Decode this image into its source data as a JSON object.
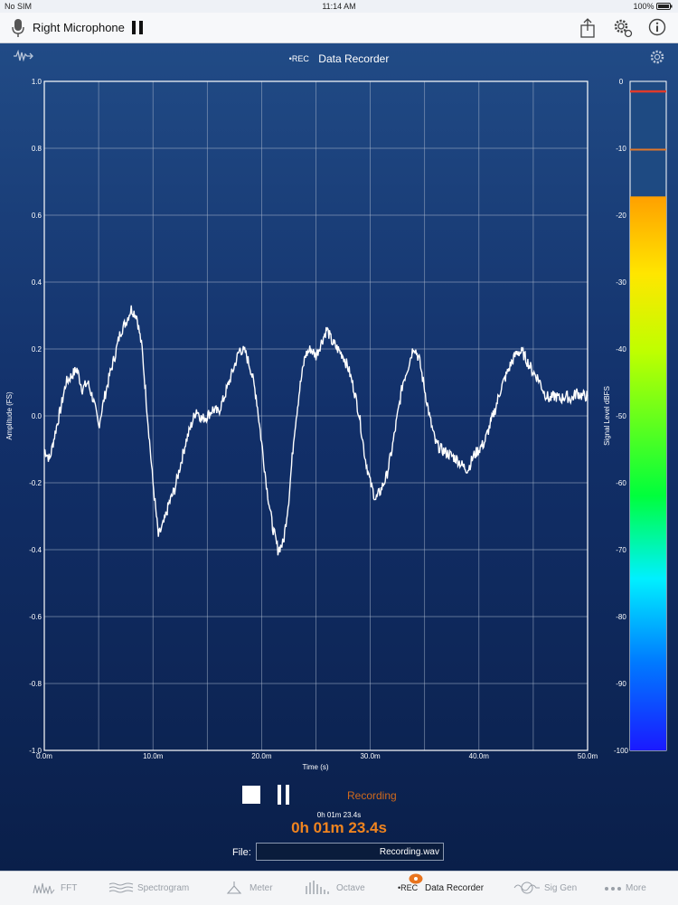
{
  "status_bar": {
    "carrier": "No SIM",
    "time": "11:14 AM",
    "battery": "100%"
  },
  "toolbar": {
    "input_source": "Right Microphone",
    "icons": [
      "microphone-icon",
      "pause-icon",
      "share-icon",
      "settings-icon",
      "info-icon"
    ]
  },
  "header": {
    "rec_tag": "•REC",
    "title": "Data Recorder"
  },
  "colors": {
    "trace": "#ffffff",
    "grid": "#aab7cc",
    "accent": "#f0841f",
    "background": "#0b2450"
  },
  "chart_data": [
    {
      "type": "line",
      "xlabel": "Time (s)",
      "ylabel": "Amplitude (FS)",
      "xlim": [
        0,
        50
      ],
      "ylim": [
        -1,
        1
      ],
      "grid": true,
      "x_ticks": [
        "0.0m",
        "10.0m",
        "20.0m",
        "30.0m",
        "40.0m",
        "50.0m"
      ],
      "y_ticks": [
        "1.0",
        "0.8",
        "0.6",
        "0.4",
        "0.2",
        "0.0",
        "-0.2",
        "-0.4",
        "-0.6",
        "-0.8",
        "-1.0"
      ],
      "series": [
        {
          "x": [
            0,
            0.5,
            1.0,
            1.5,
            2.0,
            2.5,
            3.0,
            3.5,
            4.0,
            4.5,
            5.0,
            5.5,
            6.0,
            6.5,
            7.0,
            7.5,
            8.0,
            8.5,
            9.0,
            9.5,
            10.0,
            10.5,
            11.0,
            11.5,
            12.0,
            12.5,
            13.0,
            13.5,
            14.0,
            14.5,
            15.0,
            15.5,
            16.0,
            16.5,
            17.0,
            17.5,
            18.0,
            18.5,
            19.0,
            19.5,
            20.0,
            20.5,
            21.0,
            21.5,
            22.0,
            22.5,
            23.0,
            23.5,
            24.0,
            24.5,
            25.0,
            25.5,
            26.0,
            26.5,
            27.0,
            27.5,
            28.0,
            28.5,
            29.0,
            29.5,
            30.0,
            30.5,
            31.0,
            31.5,
            32.0,
            32.5,
            33.0,
            33.5,
            34.0,
            34.5,
            35.0,
            35.5,
            36.0,
            36.5,
            37.0,
            37.5,
            38.0,
            38.5,
            39.0,
            39.5,
            40.0,
            40.5,
            41.0,
            41.5,
            42.0,
            42.5,
            43.0,
            43.5,
            44.0,
            44.5,
            45.0,
            45.5,
            46.0,
            46.5,
            47.0,
            47.5,
            48.0,
            48.5,
            49.0,
            49.5,
            50.0
          ],
          "y": [
            -0.1,
            -0.13,
            -0.05,
            0.02,
            0.1,
            0.12,
            0.14,
            0.08,
            0.1,
            0.05,
            -0.03,
            0.05,
            0.12,
            0.18,
            0.25,
            0.28,
            0.32,
            0.3,
            0.2,
            0.0,
            -0.2,
            -0.36,
            -0.32,
            -0.26,
            -0.22,
            -0.15,
            -0.08,
            -0.03,
            0.02,
            -0.01,
            0.0,
            0.02,
            0.01,
            0.05,
            0.1,
            0.15,
            0.2,
            0.19,
            0.14,
            0.06,
            -0.08,
            -0.22,
            -0.33,
            -0.4,
            -0.38,
            -0.25,
            -0.05,
            0.08,
            0.18,
            0.2,
            0.18,
            0.22,
            0.26,
            0.22,
            0.2,
            0.18,
            0.14,
            0.08,
            0.0,
            -0.12,
            -0.2,
            -0.25,
            -0.22,
            -0.18,
            -0.1,
            0.0,
            0.1,
            0.15,
            0.21,
            0.17,
            0.08,
            -0.01,
            -0.08,
            -0.1,
            -0.11,
            -0.12,
            -0.13,
            -0.15,
            -0.16,
            -0.12,
            -0.1,
            -0.08,
            -0.03,
            0.02,
            0.08,
            0.12,
            0.16,
            0.19,
            0.19,
            0.16,
            0.13,
            0.11,
            0.07,
            0.05,
            0.06,
            0.05,
            0.06,
            0.05,
            0.07,
            0.06,
            0.06
          ]
        }
      ]
    },
    {
      "type": "bar",
      "ylabel": "Signal Level dBFS",
      "ylim": [
        -100,
        0
      ],
      "y_ticks": [
        "0",
        "-10",
        "-20",
        "-30",
        "-40",
        "-50",
        "-60",
        "-70",
        "-80",
        "-90",
        "-100"
      ],
      "level": -17.2,
      "peak_hold": -1.5,
      "peak_marker": -10.2
    }
  ],
  "controls": {
    "recording_status": "Recording",
    "elapsed_small": "0h 01m 23.4s",
    "elapsed_large": "0h 01m 23.4s",
    "file_label": "File:",
    "file_name": "Recording.wav"
  },
  "tabs": [
    {
      "label": "FFT",
      "icon": "fft-icon"
    },
    {
      "label": "Spectrogram",
      "icon": "spectrogram-icon"
    },
    {
      "label": "Meter",
      "icon": "meter-icon"
    },
    {
      "label": "Octave",
      "icon": "octave-icon"
    },
    {
      "label": "•REC",
      "sub": "Data Recorder",
      "icon": "record-icon",
      "active": true
    },
    {
      "label": "Sig Gen",
      "icon": "sig-gen-icon"
    },
    {
      "label": "More",
      "icon": "more-icon"
    }
  ]
}
